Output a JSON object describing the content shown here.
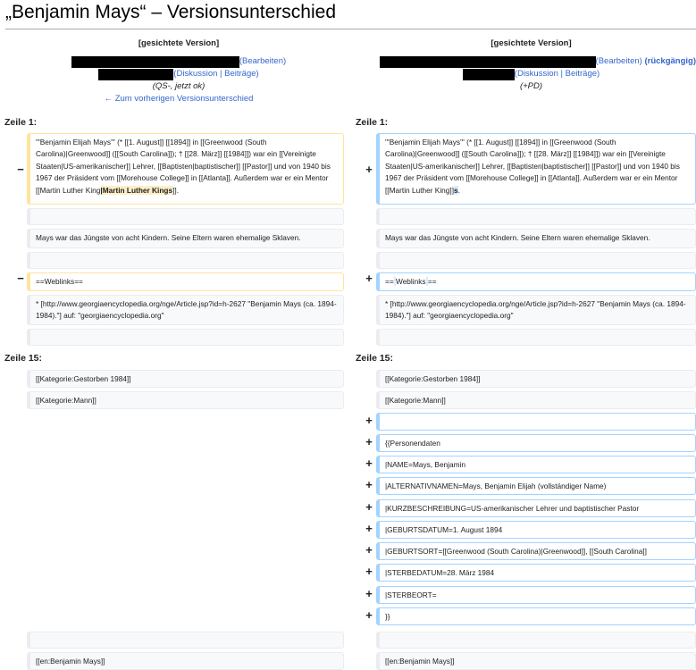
{
  "page": {
    "title": "„Benjamin Mays“ – Versionsunterschied"
  },
  "left_header": {
    "version_label": "[gesichtete Version]",
    "edit_link": "(Bearbeiten)",
    "talk_contrib": "(Diskussion | Beiträge)",
    "summary": "(QS-, jetzt ok)",
    "prev_diff_link": "← Zum vorherigen Versionsunterschied"
  },
  "right_header": {
    "version_label": "[gesichtete Version]",
    "edit_link": "(Bearbeiten)",
    "undo_link": "(rückgängig)",
    "talk_contrib": "(Diskussion | Beiträge)",
    "summary": "(+PD)"
  },
  "line_headers": {
    "l1": "Zeile 1:",
    "r1": "Zeile 1:",
    "l15": "Zeile 15:",
    "r15": "Zeile 15:"
  },
  "markers": {
    "minus": "−",
    "plus": "+"
  },
  "left_rows": {
    "row1_before": "'''Benjamin Elijah Mays''' (* [[1. August]] [[1894]] in [[Greenwood (South Carolina)|Greenwood]] ([[South Carolina]]); † [[28. März]] [[1984]]) war ein [[Vereinigte Staaten|US-amerikanischer]] Lehrer, [[Baptisten|baptistischer]] [[Pastor]] und von 1940 bis 1967 der Präsident vom [[Morehouse College]] in [[Atlanta]]. Außerdem war er ein Mentor [[Martin Luther King",
    "row1_hl": "|Martin Luther Kings",
    "row1_after": "]].",
    "row3": "Mays war das Jüngste von acht Kindern. Seine Eltern waren ehemalige Sklaven.",
    "row5": "==Weblinks==",
    "row6": "* [http://www.georgiaencyclopedia.org/nge/Article.jsp?id=h-2627 \"Benjamin Mays (ca. 1894-1984).\"] auf: \"georgiaencyclopedia.org\"",
    "row8": "[[Kategorie:Gestorben 1984]]",
    "row9": "[[Kategorie:Mann]]",
    "row_last": "[[en:Benjamin Mays]]"
  },
  "right_rows": {
    "row1_before": "'''Benjamin Elijah Mays''' (* [[1. August]] [[1894]] in [[Greenwood (South Carolina)|Greenwood]] ([[South Carolina]]); † [[28. März]] [[1984]]) war ein [[Vereinigte Staaten|US-amerikanischer]] Lehrer, [[Baptisten|baptistischer]] [[Pastor]] und von 1940 bis 1967 der Präsident vom [[Morehouse College]] in [[Atlanta]]. Außerdem war er ein Mentor [[Martin Luther King]]",
    "row1_hl": "s",
    "row1_after": ".",
    "row3": "Mays war das Jüngste von acht Kindern. Seine Eltern waren ehemalige Sklaven.",
    "row5_a": "==",
    "row5_hl1": " ",
    "row5_b": "Weblinks",
    "row5_hl2": " ",
    "row5_c": "==",
    "row6": "* [http://www.georgiaencyclopedia.org/nge/Article.jsp?id=h-2627 \"Benjamin Mays (ca. 1894-1984).\"] auf: \"georgiaencyclopedia.org\"",
    "row8": "[[Kategorie:Gestorben 1984]]",
    "row9": "[[Kategorie:Mann]]",
    "added": [
      "",
      "{{Personendaten",
      "|NAME=Mays, Benjamin",
      "|ALTERNATIVNAMEN=Mays, Benjamin Elijah (vollständiger Name)",
      "|KURZBESCHREIBUNG=US-amerikanischer Lehrer und baptistischer Pastor",
      "|GEBURTSDATUM=1. August 1894",
      "|GEBURTSORT=[[Greenwood (South Carolina)|Greenwood]], [[South Carolina]]",
      "|STERBEDATUM=28. März 1984",
      "|STERBEORT=",
      "}}"
    ],
    "row_last": "[[en:Benjamin Mays]]"
  }
}
